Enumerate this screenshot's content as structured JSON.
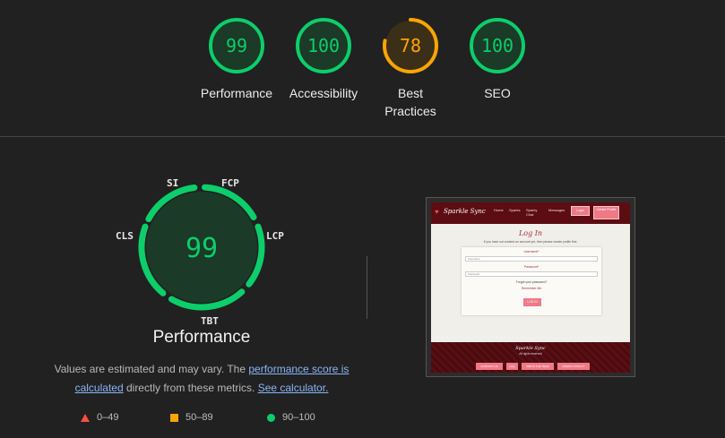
{
  "scores": [
    {
      "key": "performance",
      "value": "99",
      "fraction": 0.99,
      "label": "Performance",
      "color": "#0cce6b",
      "fill": "#1b3a27"
    },
    {
      "key": "accessibility",
      "value": "100",
      "fraction": 1.0,
      "label": "Accessibility",
      "color": "#0cce6b",
      "fill": "#1b3a27"
    },
    {
      "key": "best-practices",
      "value": "78",
      "fraction": 0.78,
      "label_line1": "Best",
      "label_line2": "Practices",
      "color": "#ffa400",
      "fill": "#3b2f18"
    },
    {
      "key": "seo",
      "value": "100",
      "fraction": 1.0,
      "label": "SEO",
      "color": "#0cce6b",
      "fill": "#1b3a27"
    }
  ],
  "performance_detail": {
    "score": "99",
    "title": "Performance",
    "metrics": [
      "SI",
      "FCP",
      "LCP",
      "TBT",
      "CLS"
    ],
    "estimate_text_1": "Values are estimated and may vary. The ",
    "estimate_link_1": "performance score is calculated",
    "estimate_text_2": " directly from these metrics. ",
    "estimate_link_2": "See calculator."
  },
  "legend": [
    {
      "icon": "triangle-icon",
      "range": "0–49",
      "color": "#ff4e42"
    },
    {
      "icon": "square-icon",
      "range": "50–89",
      "color": "#ffa400"
    },
    {
      "icon": "circle-icon",
      "range": "90–100",
      "color": "#0cce6b"
    }
  ],
  "screenshot": {
    "logo": "Sparkle Sync",
    "nav": [
      "Home",
      "Sparks",
      "Sparky Chat",
      "Messages"
    ],
    "nav_buttons": [
      "Login",
      "Create Profile"
    ],
    "title": "Log In",
    "subtitle": "If you have not created an account yet, then please create profile first.",
    "username_label": "Username*",
    "username_placeholder": "Username",
    "password_label": "Password*",
    "password_placeholder": "Password",
    "forgot": "Forgot your password?",
    "remember": "Remember Me",
    "login_button": "LOG IN",
    "footer_logo": "Sparkle Sync",
    "footer_rights": "All rights reserved",
    "footer_buttons": [
      "CONTACT US",
      "FAQ",
      "WRITE THE TEAM",
      "PRIVACY POLICY"
    ]
  }
}
